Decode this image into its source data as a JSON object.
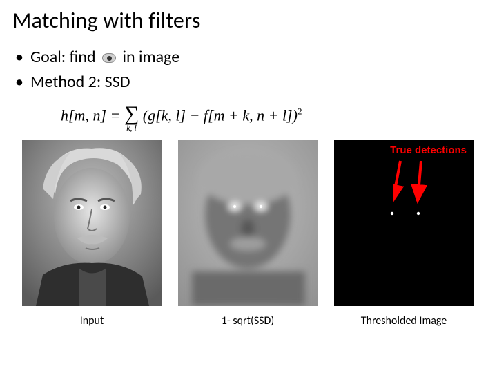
{
  "title": "Matching with filters",
  "bullets": {
    "goal_pre": "Goal: find",
    "goal_post": " in image",
    "method": "Method 2: SSD"
  },
  "formula": {
    "lhs": "h[m, n] = ",
    "sum_sub": "k, l",
    "body": "(g[k, l] − f[m + k, n + l])",
    "exp": "2"
  },
  "panels": {
    "input_caption": "Input",
    "ssd_caption": "1- sqrt(SSD)",
    "thresh_caption": "Thresholded Image",
    "true_det_label": "True detections"
  },
  "icons": {
    "eye": "eye-icon",
    "arrow": "arrow-icon"
  }
}
